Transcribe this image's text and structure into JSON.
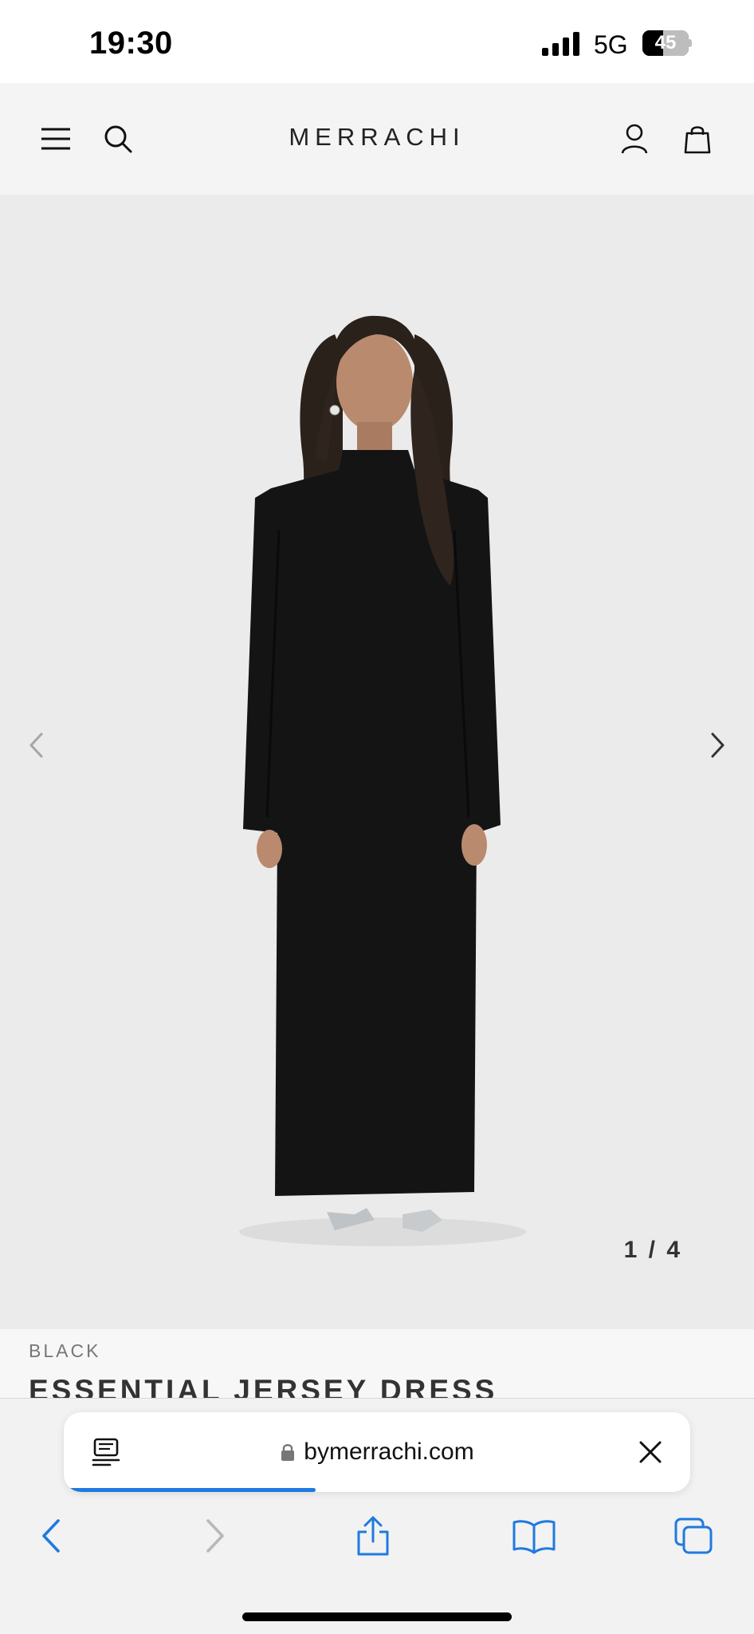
{
  "status_bar": {
    "time": "19:30",
    "network": "5G",
    "battery_level": "45",
    "battery_fraction": 0.45
  },
  "header": {
    "logo": "MERRACHI",
    "icons": [
      "menu-icon",
      "search-icon",
      "account-icon",
      "bag-icon"
    ]
  },
  "gallery": {
    "counter": "1 / 4",
    "prev_icon": "chevron-left-icon",
    "next_icon": "chevron-right-icon"
  },
  "product": {
    "color": "BLACK",
    "title": "ESSENTIAL JERSEY DRESS"
  },
  "browser": {
    "url": "bymerrachi.com",
    "load_progress": 0.4,
    "accent_color": "#1f7ae0",
    "toolbar_icons": [
      "back-icon",
      "forward-icon",
      "share-icon",
      "bookmarks-icon",
      "tabs-icon"
    ]
  }
}
